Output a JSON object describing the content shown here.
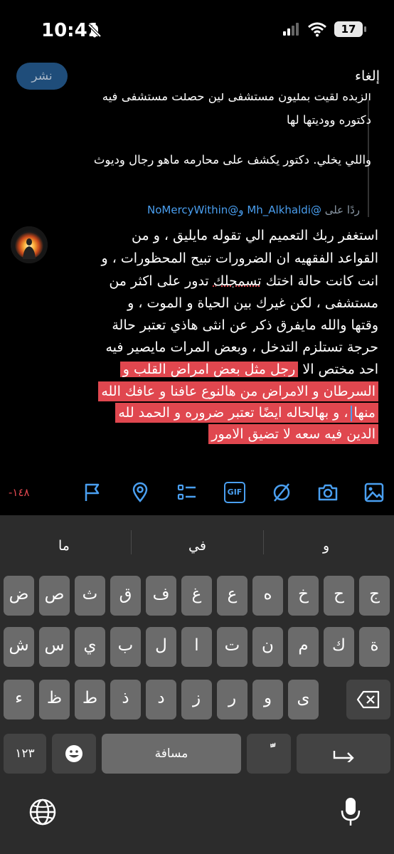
{
  "status_bar": {
    "time": "10:41",
    "battery": "17"
  },
  "compose": {
    "publish_label": "نشر",
    "cancel_label": "إلغاء"
  },
  "quoted": {
    "line1": "الزبده لقيت بمليون مستشفى لين حصلت مستشفى فيه",
    "line2": "دكتوره ووديتها لها",
    "line3": "واللي يخلي. دكتور يكشف على محارمه ماهو رجال وديوث",
    "reply_prefix": "ردًا على",
    "reply_handles": "@Mh_Alkhaldi و@NoMercyWithin"
  },
  "body_lines": {
    "l1": "استغفر ربك التعميم الي تقوله مايليق ، و من",
    "l2": "القواعد الفقهيه ان الضرورات تبيح المحظورات ، و",
    "l3a": "انت كانت حالة اختك ",
    "l3b": "تسمجلك",
    "l3c": " تدور على اكثر من",
    "l4": "مستشفى ، لكن غيرك بين الحياة و الموت ، و",
    "l5": "وقتها والله مايفرق ذكر عن انثى هاذي تعتبر حالة",
    "l6": "حرجة تستلزم التدخل ، وبعض المرات مايصير فيه",
    "l7a": "احد مختص الا ",
    "l7b": "رجل مثل بعض امراض القلب و",
    "l8": "السرطان و الامراض من هالنوع عافنا و عافك الله",
    "l9a": "منها",
    "l9b": "، و بهالحاله ايضًا تعتبر ضروره و الحمد لله",
    "l10": "الدين فيه سعه لا تضيق الامور"
  },
  "toolbar": {
    "counter": "-١٤٨",
    "icons": [
      "flag-icon",
      "location-icon",
      "poll-icon",
      "gif-icon",
      "emoji-off-icon",
      "camera-icon",
      "image-icon"
    ],
    "gif_label": "GIF"
  },
  "keyboard": {
    "suggestions": [
      "ما",
      "في",
      "و"
    ],
    "row1": [
      "ض",
      "ص",
      "ث",
      "ق",
      "ف",
      "غ",
      "ع",
      "ه",
      "خ",
      "ح",
      "ج"
    ],
    "row2": [
      "ش",
      "س",
      "ي",
      "ب",
      "ل",
      "ا",
      "ت",
      "ن",
      "م",
      "ك",
      "ة"
    ],
    "row3": [
      "ء",
      "ظ",
      "ط",
      "ذ",
      "د",
      "ز",
      "ر",
      "و",
      "ى"
    ],
    "numbers_label": "١٢٣",
    "space_label": "مسافة",
    "diacritic_label": "ًّ"
  },
  "colors": {
    "accent": "#4a9ff0",
    "selection": "#e0474f",
    "keyboard_bg": "#2c2c2c"
  }
}
